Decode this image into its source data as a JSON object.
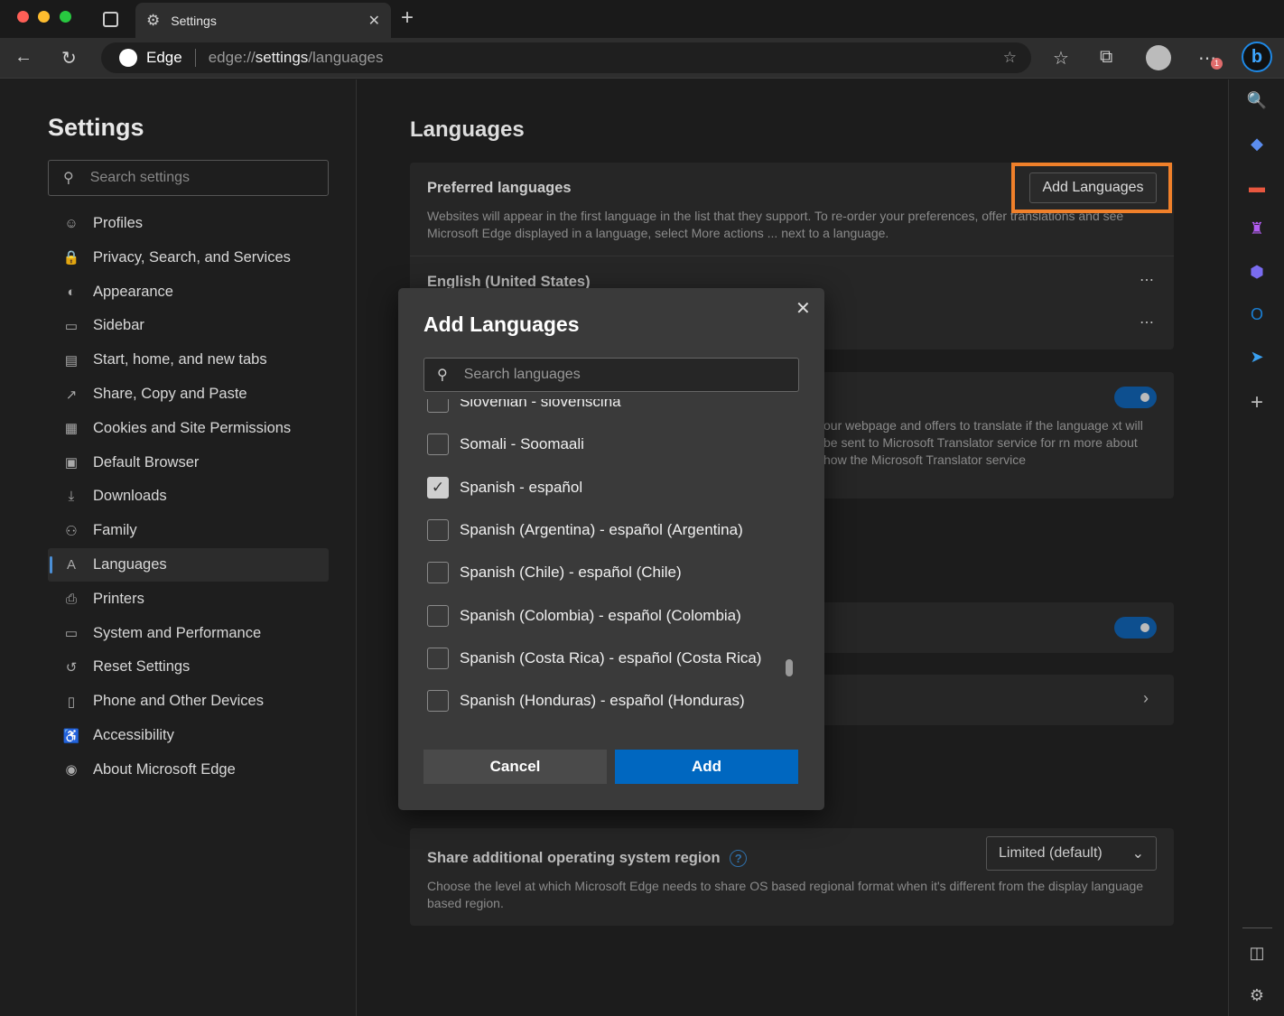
{
  "browser": {
    "tab_title": "Settings",
    "address_brand": "Edge",
    "url_prefix": "edge://",
    "url_bold": "settings",
    "url_suffix": "/languages",
    "notification_badge": "1"
  },
  "sidebar": {
    "title": "Settings",
    "search_placeholder": "Search settings",
    "items": [
      {
        "label": "Profiles",
        "icon": "profile-icon",
        "glyph": "☺"
      },
      {
        "label": "Privacy, Search, and Services",
        "icon": "lock-icon",
        "glyph": "🔒"
      },
      {
        "label": "Appearance",
        "icon": "palette-icon",
        "glyph": "◐"
      },
      {
        "label": "Sidebar",
        "icon": "sidebar-icon",
        "glyph": "▭"
      },
      {
        "label": "Start, home, and new tabs",
        "icon": "home-tabs-icon",
        "glyph": "▤"
      },
      {
        "label": "Share, Copy and Paste",
        "icon": "share-icon",
        "glyph": "↗"
      },
      {
        "label": "Cookies and Site Permissions",
        "icon": "cookies-icon",
        "glyph": "▦"
      },
      {
        "label": "Default Browser",
        "icon": "browser-icon",
        "glyph": "▣"
      },
      {
        "label": "Downloads",
        "icon": "download-icon",
        "glyph": "⤓"
      },
      {
        "label": "Family",
        "icon": "family-icon",
        "glyph": "⚇"
      },
      {
        "label": "Languages",
        "icon": "languages-icon",
        "glyph": "A",
        "selected": true
      },
      {
        "label": "Printers",
        "icon": "printer-icon",
        "glyph": "⎙"
      },
      {
        "label": "System and Performance",
        "icon": "laptop-icon",
        "glyph": "▭"
      },
      {
        "label": "Reset Settings",
        "icon": "reset-icon",
        "glyph": "↺"
      },
      {
        "label": "Phone and Other Devices",
        "icon": "phone-icon",
        "glyph": "▯"
      },
      {
        "label": "Accessibility",
        "icon": "accessibility-icon",
        "glyph": "♿"
      },
      {
        "label": "About Microsoft Edge",
        "icon": "edge-icon",
        "glyph": "◉"
      }
    ]
  },
  "main": {
    "title": "Languages",
    "preferred": {
      "title": "Preferred languages",
      "button": "Add Languages",
      "desc": "Websites will appear in the first language in the list that they support. To re-order your preferences, offer translations and see Microsoft Edge displayed in a language, select More actions ... next to a language.",
      "languages": [
        "English (United States)"
      ]
    },
    "translate_desc": "our webpage and offers to translate if the language xt will be sent to Microsoft Translator service for rn more about how the Microsoft Translator service",
    "region": {
      "title": "Share additional operating system region",
      "select": "Limited (default)",
      "desc": "Choose the level at which Microsoft Edge needs to share OS based regional format when it's different from the display language based region."
    }
  },
  "dialog": {
    "title": "Add Languages",
    "search_placeholder": "Search languages",
    "cancel": "Cancel",
    "add": "Add",
    "options": [
      {
        "label": "Slovenian - slovenščina",
        "checked": false
      },
      {
        "label": "Somali - Soomaali",
        "checked": false
      },
      {
        "label": "Spanish - español",
        "checked": true
      },
      {
        "label": "Spanish (Argentina) - español (Argentina)",
        "checked": false
      },
      {
        "label": "Spanish (Chile) - español (Chile)",
        "checked": false
      },
      {
        "label": "Spanish (Colombia) - español (Colombia)",
        "checked": false
      },
      {
        "label": "Spanish (Costa Rica) - español (Costa Rica)",
        "checked": false
      },
      {
        "label": "Spanish (Honduras) - español (Honduras)",
        "checked": false
      }
    ]
  },
  "colors": {
    "accent": "#0067c0",
    "highlight": "#f0802a"
  }
}
